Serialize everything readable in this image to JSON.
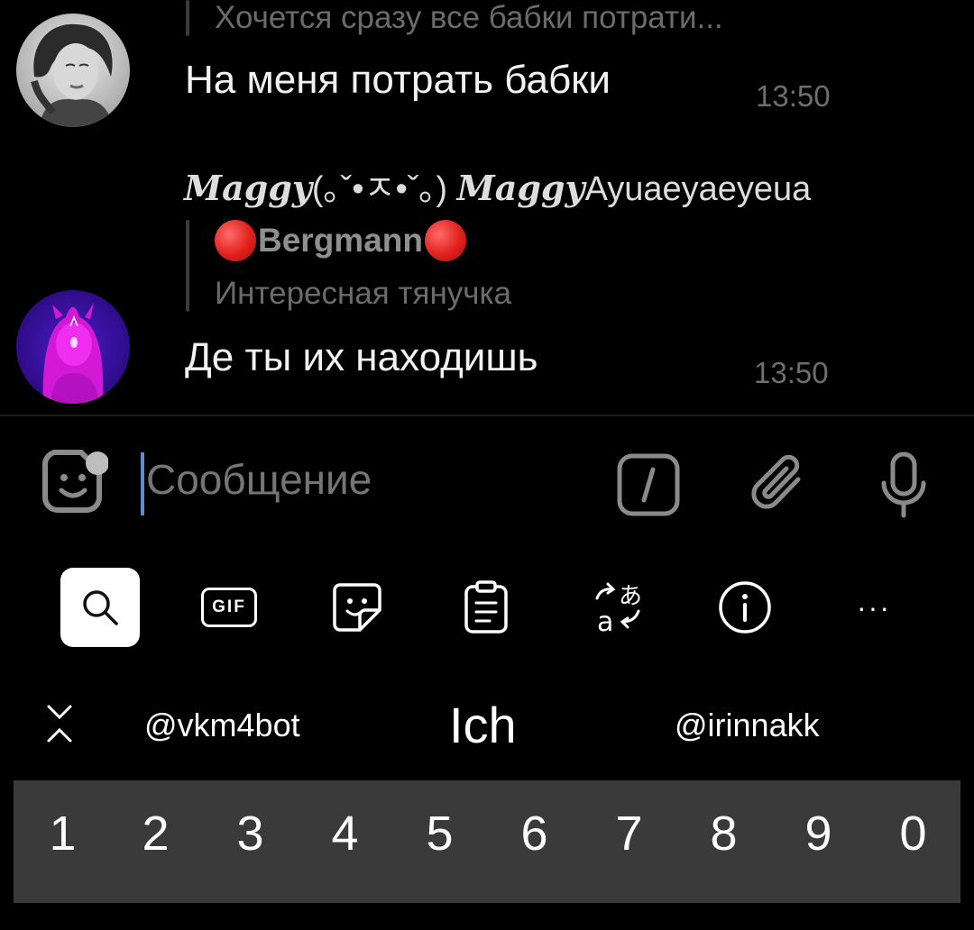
{
  "chat": {
    "messages": [
      {
        "reply_preview": "Хочется сразу все бабки потрати...",
        "text": "На меня потрать бабки",
        "time": "13:50",
        "avatar": "avatar-woman-photo"
      },
      {
        "sender_script_a": "Maggy",
        "sender_kaomoji": "(｡ˇ•ㅈ•ˇ｡)",
        "sender_script_b": "Maggy",
        "sender_suffix": "Ayuaeyaeyeua",
        "reply_name": "Bergmann",
        "reply_preview": "Интересная тянучка",
        "text": "Де ты их находишь",
        "time": "13:50",
        "avatar": "avatar-pink-girl"
      }
    ]
  },
  "composer": {
    "placeholder": "Сообщение",
    "icons": [
      "sticker-icon",
      "command-icon",
      "attach-icon",
      "mic-icon"
    ]
  },
  "keyboard": {
    "toolbar": [
      "search-icon",
      "gif-icon",
      "sticker-icon",
      "clipboard-icon",
      "translate-icon",
      "info-icon",
      "more-icon"
    ],
    "gif_label": "GIF",
    "more_label": "···",
    "suggestions": {
      "left": "@vkm4bot",
      "center": "Ich",
      "right": "@irinnakk"
    },
    "number_row": [
      "1",
      "2",
      "3",
      "4",
      "5",
      "6",
      "7",
      "8",
      "9",
      "0"
    ]
  },
  "colors": {
    "background": "#000000",
    "cursor": "#5a8fd8",
    "number_row_bg": "#3a3a3a",
    "reply_bar": "#3a3a3a"
  }
}
